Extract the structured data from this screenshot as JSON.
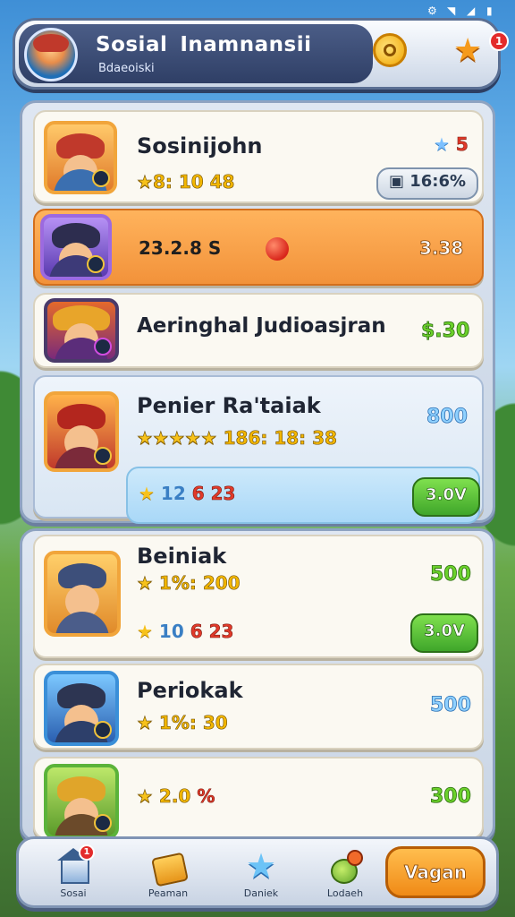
{
  "header": {
    "title_part1": "Sosial",
    "title_part2": "Inamnansii",
    "subtitle": "Bdaeoiski",
    "star_badge": "1"
  },
  "cards": [
    {
      "name": "Sosinijohn",
      "stars_text": "8: 10 48",
      "right_top": "5",
      "right_pill": "16:6%"
    },
    {
      "left_text": "23.2.8 S",
      "right_text": "3.38"
    },
    {
      "name": "Aeringhal Judioasjran",
      "price": "$.30"
    },
    {
      "name": "Penier Ra'taiak",
      "stars_text": "186: 18: 38",
      "price": "800",
      "sub": {
        "n1": "12",
        "n2": "6",
        "n3": "23",
        "button": "3.0V"
      }
    }
  ],
  "cards2": [
    {
      "name": "Beiniak",
      "stars_text": "1%: 200",
      "price": "500",
      "row2": {
        "n1": "10",
        "n2": "6",
        "n3": "23",
        "button": "3.0V"
      }
    },
    {
      "name": "Periokak",
      "stars_text": "1%: 30",
      "price": "500"
    },
    {
      "stars_text": "2.0",
      "red": "%",
      "price": "300"
    }
  ],
  "nav": {
    "items": [
      {
        "label": "Sosai",
        "badge": "1"
      },
      {
        "label": "Peaman"
      },
      {
        "label": "Daniek"
      },
      {
        "label": "Lodaeh"
      }
    ],
    "primary_button": "Vagan"
  },
  "colors": {
    "accent_orange": "#f2923a",
    "price_green": "#6bd12b",
    "price_blue": "#8fd1ff",
    "star_yellow": "#f7c21b"
  }
}
